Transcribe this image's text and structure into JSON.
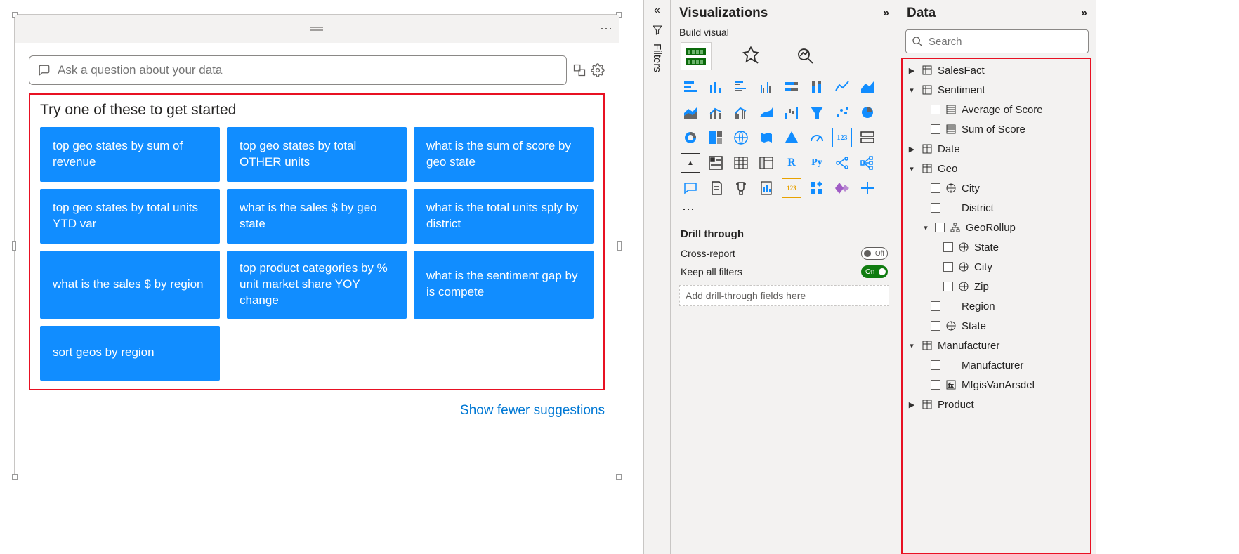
{
  "qa": {
    "placeholder": "Ask a question about your data",
    "try_heading": "Try one of these to get started",
    "suggestions": [
      "top geo states by sum of revenue",
      "top geo states by total OTHER units",
      "what is the sum of score by geo state",
      "top geo states by total units YTD var",
      "what is the sales $ by geo state",
      "what is the total units sply by district",
      "what is the sales $ by region",
      "top product categories by % unit market share YOY change",
      "what is the sentiment gap by is compete",
      "sort geos by region"
    ],
    "show_fewer": "Show fewer suggestions"
  },
  "filters_label": "Filters",
  "vis": {
    "title": "Visualizations",
    "build_label": "Build visual",
    "drill_heading": "Drill through",
    "cross_report": "Cross-report",
    "keep_filters": "Keep all filters",
    "drill_drop": "Add drill-through fields here",
    "toggle_off": "Off",
    "toggle_on": "On"
  },
  "data": {
    "title": "Data",
    "search_placeholder": "Search",
    "tree": {
      "salesfact": "SalesFact",
      "sentiment": "Sentiment",
      "avg_score": "Average of Score",
      "sum_score": "Sum of Score",
      "date": "Date",
      "geo": "Geo",
      "city": "City",
      "district": "District",
      "georollup": "GeoRollup",
      "gr_state": "State",
      "gr_city": "City",
      "gr_zip": "Zip",
      "region": "Region",
      "state": "State",
      "manufacturer": "Manufacturer",
      "mfg_field": "Manufacturer",
      "mfg_isvan": "MfgisVanArsdel",
      "product": "Product"
    }
  }
}
